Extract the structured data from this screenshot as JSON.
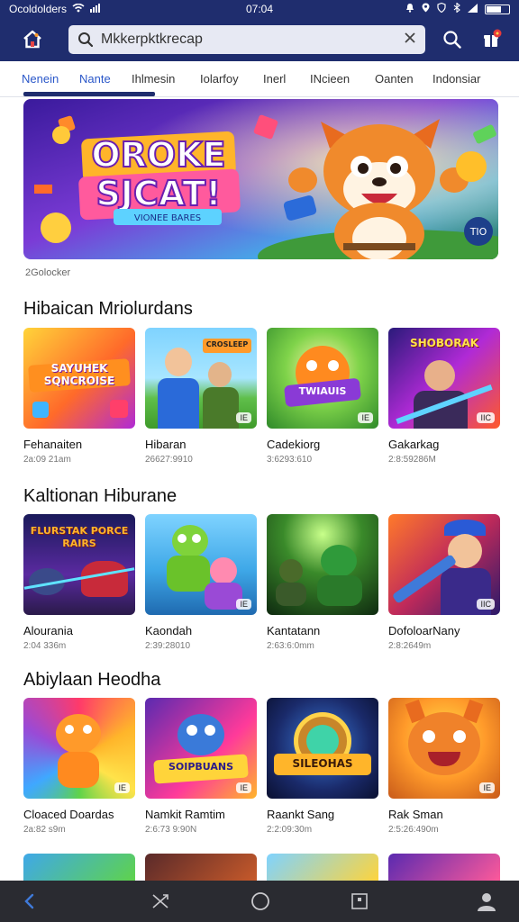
{
  "status": {
    "carrier": "Ocoldolders",
    "time": "07:04"
  },
  "search": {
    "value": "Mkkerpktkrecap"
  },
  "tabs": [
    "Nenein",
    "Nante",
    "Ihlmesin",
    "Iolarfoy",
    "Inerl",
    "INcieen",
    "Oanten",
    "Indonsiar"
  ],
  "banner": {
    "title_line1": "OROKE",
    "title_line2": "SJCAT!",
    "tagline": "VIONEE BARES",
    "badge": "TIO",
    "caption": "2Golocker"
  },
  "sections": [
    {
      "title": "Hibaican Mriolurdans",
      "items": [
        {
          "title": "Fehanaiten",
          "sub": "2a:09 21am",
          "thumb_text": "SAYUHEK SQNCROISE",
          "badge": ""
        },
        {
          "title": "Hibaran",
          "sub": "26627:9910",
          "thumb_text": "CROSLEEP",
          "badge": "IE"
        },
        {
          "title": "Cadekiorg",
          "sub": "3:6293:610",
          "thumb_text": "TWIAUIS",
          "badge": "IE"
        },
        {
          "title": "Gakarkag",
          "sub": "2:8:59286M",
          "thumb_text": "SHOBORAK",
          "badge": "IIC"
        }
      ]
    },
    {
      "title": "Kaltionan Hiburane",
      "items": [
        {
          "title": "Alourania",
          "sub": "2:04 336m",
          "thumb_text": "FLURSTAK PORCE RAIRS",
          "badge": ""
        },
        {
          "title": "Kaondah",
          "sub": "2:39:28010",
          "thumb_text": "",
          "badge": "IE"
        },
        {
          "title": "Kantatann",
          "sub": "2:63:6:0mm",
          "thumb_text": "",
          "badge": ""
        },
        {
          "title": "DofoloarNany",
          "sub": "2:8:2649m",
          "thumb_text": "",
          "badge": "IIC"
        }
      ]
    },
    {
      "title": "Abiylaan Heodha",
      "items": [
        {
          "title": "Cloaced Doardas",
          "sub": "2a:82 s9m",
          "thumb_text": "",
          "badge": "IE"
        },
        {
          "title": "Namkit Ramtim",
          "sub": "2:6:73 9:90N",
          "thumb_text": "SOIPBUANS",
          "badge": "IE"
        },
        {
          "title": "Raankt Sang",
          "sub": "2:2:09:30m",
          "thumb_text": "SILEOHAS",
          "badge": ""
        },
        {
          "title": "Rak Sman",
          "sub": "2:5:26:490m",
          "thumb_text": "",
          "badge": "IE"
        }
      ]
    }
  ]
}
